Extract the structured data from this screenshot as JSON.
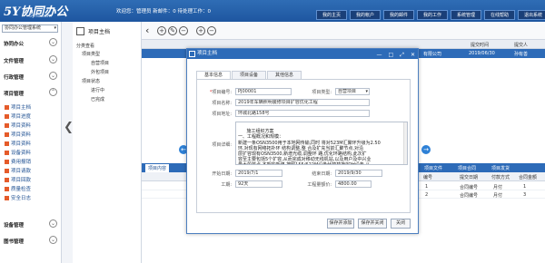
{
  "header": {
    "logo_text": "5Y协同办公",
    "logo_sub": "5yhb.com",
    "welcome": "欢迎您：管理员 新邮件：0    待处理工作：0",
    "nav": [
      "我的主页",
      "我的帐户",
      "我的邮件",
      "我的工作",
      "系统管理",
      "在线帮助",
      "退出系统"
    ]
  },
  "sidebar": {
    "system_select": "协同办公管理系统",
    "groups": [
      {
        "label": "协同办公",
        "icon": "chevron-down-icon"
      },
      {
        "label": "文件管理",
        "icon": "chevron-down-icon"
      },
      {
        "label": "行政管理",
        "icon": "chevron-down-icon"
      },
      {
        "label": "项目管理",
        "icon": "chevron-up-icon"
      }
    ],
    "project_items": [
      "项目主档",
      "项目进度",
      "项目资料",
      "项目资料",
      "项目资料",
      "设备资料",
      "费用报销",
      "项目请款",
      "项目回款",
      "质量检查",
      "安全日志"
    ],
    "bottom_groups": [
      {
        "label": "设备管理",
        "icon": "chevron-down-icon"
      },
      {
        "label": "图书管理",
        "icon": "chevron-down-icon"
      }
    ]
  },
  "tree": {
    "title": "项目主档",
    "nodes": [
      "分类查看",
      "项目类型",
      "自营项目",
      "外包项目",
      "项目状态",
      "进行中",
      "已完成"
    ]
  },
  "main": {
    "table_headers": [
      "",
      "提交时间",
      "提交人"
    ],
    "selected_row": {
      "date": "2019/06/30",
      "user": "孙有善",
      "left": "有限公司"
    },
    "lower_tabs": [
      "项目内容",
      "项目进度",
      "项目资料",
      "设备资料",
      "费用报销",
      "项目请款",
      "项目回款",
      "质量检查",
      "安全日志",
      "项目文件",
      "项目合同",
      "项目发货"
    ],
    "lower_headers": [
      "编号",
      "提交日期",
      "付款方式",
      "合同金额"
    ],
    "lower_rows": [
      {
        "c1": "1",
        "c2": "合同编号",
        "c3": "月付",
        "c4": "1"
      },
      {
        "c1": "2",
        "c2": "合同编号",
        "c3": "月付",
        "c4": "3"
      }
    ]
  },
  "modal": {
    "title": "项目主档",
    "tabs": [
      "基本信息",
      "项目设备",
      "其他信息"
    ],
    "fields": {
      "project_no_label": "项目编号:",
      "project_no": "PJ00001",
      "project_type_label": "项目类型:",
      "project_type": "自营项目",
      "project_name_label": "项目名称:",
      "project_name": "2019年车辆照明装修项目扩容优化工程",
      "project_addr_label": "项目地址:",
      "project_addr": "环城北路158号",
      "project_desc_label": "项目详细:",
      "project_desc": "施工组织方案\n一、工程概况和规模：\n新建一条OSN3500用于本地网传输,同时 将对523M汇聚环升级为2.50\n环,对现有网络拓扑环 结构调整,整 合及扩充当前汇聚节点,对沿\n层扩容现有OSN3500,新增光缆,调整环 路,优化环路结构,此次扩\n容至主要包括5个扩容,从而完成对移动无线机站,以及用户及中兴业\n量大的节点,本期的新建,按照155/622M设备代替替换PDH设备,从",
      "start_date_label": "开始日期:",
      "start_date": "2019/7/1",
      "end_date_label": "结束日期:",
      "end_date": "2019/9/30",
      "period_label": "工期:",
      "period": "92天",
      "amount_label": "工程量额价:",
      "amount": "4800.00"
    },
    "buttons": [
      "保存并添加",
      "保存并关闭",
      "关闭"
    ]
  }
}
